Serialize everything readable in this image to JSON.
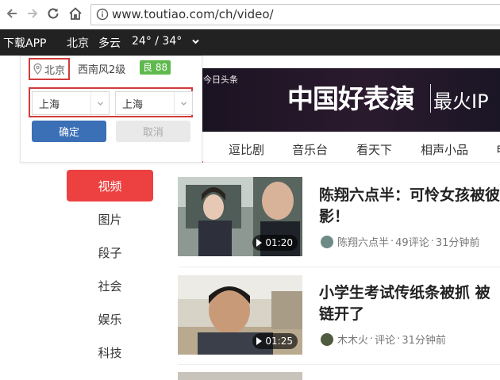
{
  "browser": {
    "url": "www.toutiao.com/ch/video/"
  },
  "topbar": {
    "download": "下载APP",
    "city": "北京",
    "weather": "多云",
    "temp": "24° / 34°"
  },
  "weather_popup": {
    "current_city": "北京",
    "wind": "西南风2级",
    "aqi": "良 88",
    "province_select": "上海",
    "city_select": "上海",
    "confirm_label": "确定",
    "cancel_label": "取消"
  },
  "banner": {
    "logo": "今日头条",
    "title": "中国好表演",
    "subtitle": "最火IP"
  },
  "tabs": [
    "逗比剧",
    "音乐台",
    "看天下",
    "相声小品",
    "电"
  ],
  "categories": [
    "视频",
    "图片",
    "段子",
    "社会",
    "娱乐",
    "科技"
  ],
  "feed": [
    {
      "title_line1": "陈翔六点半：可怜女孩被彼",
      "title_line2": "影！",
      "duration": "01:20",
      "author": "陈翔六点半",
      "comments": "49评论",
      "time": "31分钟前"
    },
    {
      "title_line1": "小学生考试传纸条被抓 被",
      "title_line2": "链开了",
      "duration": "01:25",
      "author": "木木火",
      "comments": "评论",
      "time": "31分钟前"
    }
  ],
  "colors": {
    "accent_red": "#ed4040",
    "confirm_blue": "#3b6fb6",
    "topbar_bg": "#222222",
    "aqi_green": "#5fba4e"
  }
}
